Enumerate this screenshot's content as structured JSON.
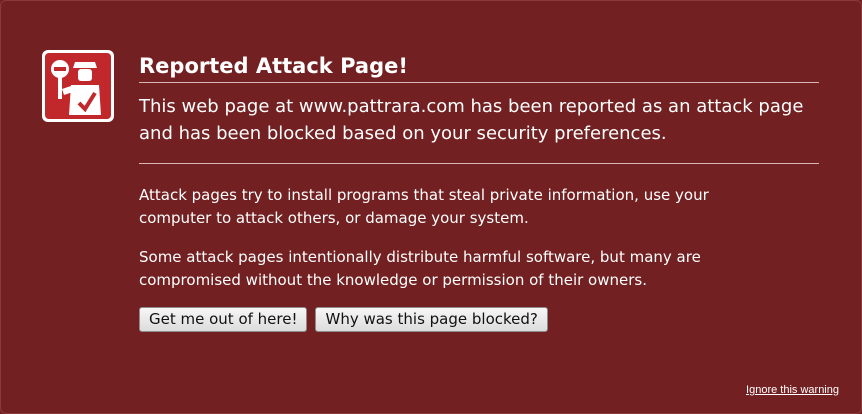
{
  "error": {
    "title": "Reported Attack Page!",
    "short_desc": "This web page at www.pattrara.com has been reported as an attack page and has been blocked based on your security preferences.",
    "long_desc_1": "Attack pages try to install programs that steal private information, use your computer to attack others, or damage your system.",
    "long_desc_2": "Some attack pages intentionally distribute harmful software, but many are compromised without the knowledge or permission of their owners.",
    "get_out_button": "Get me out of here!",
    "why_blocked_button": "Why was this page blocked?",
    "ignore_link": "Ignore this warning",
    "icon": "police-officer-stop-icon"
  },
  "colors": {
    "background": "#722021",
    "icon_red": "#c0282b",
    "text": "#ffffff"
  }
}
